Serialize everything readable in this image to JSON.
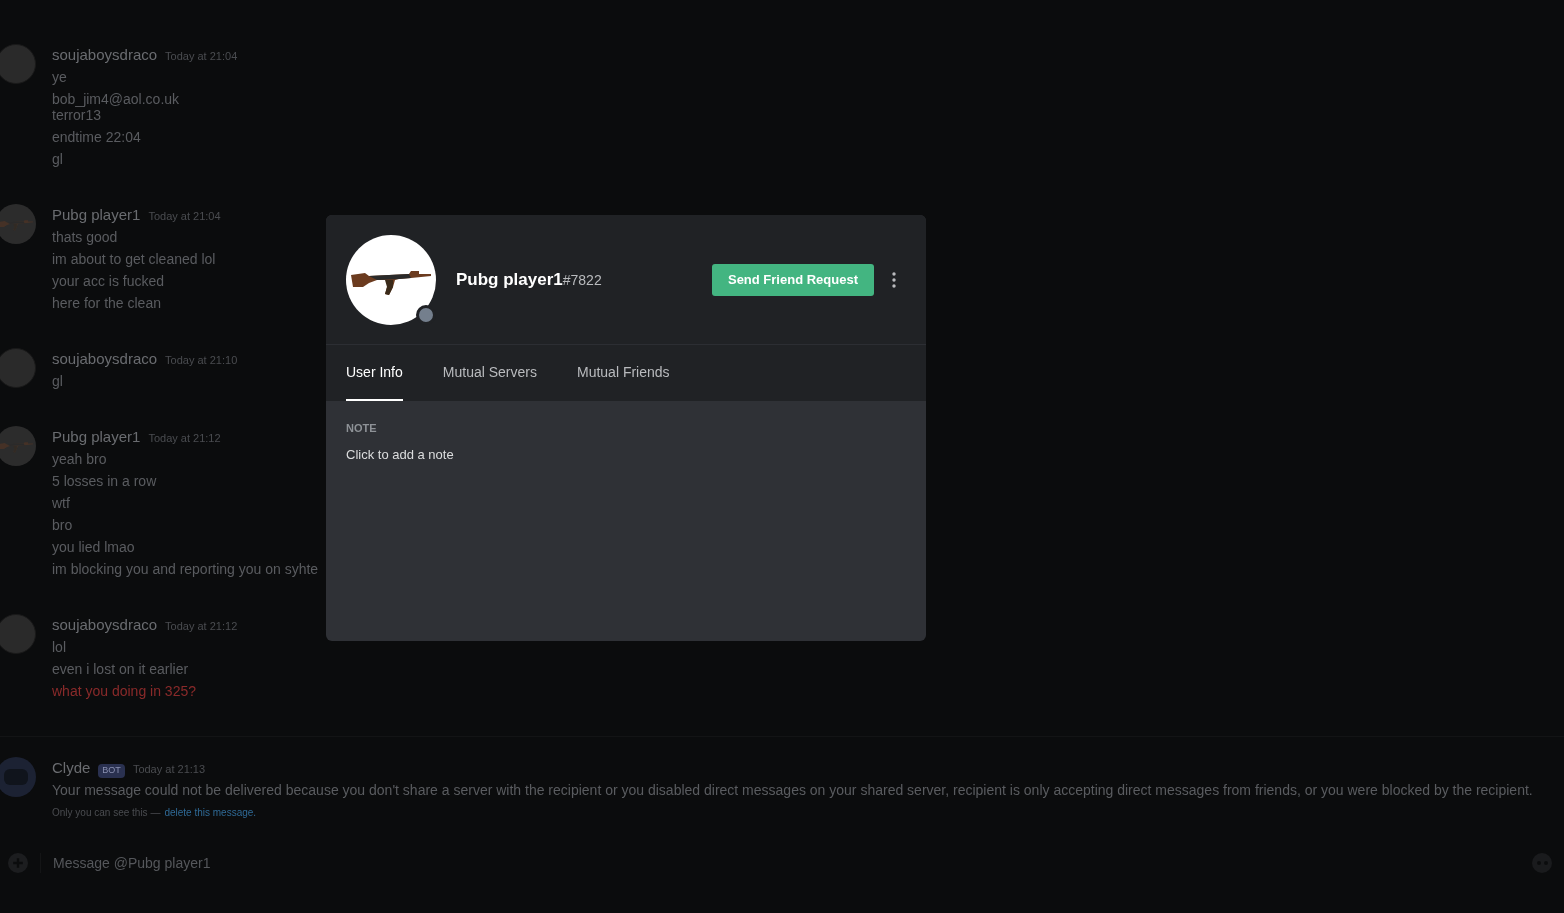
{
  "messages": [
    {
      "author": "soujaboysdraco",
      "time": "Today at 21:04",
      "kind": "face",
      "lines": [
        {
          "kind": "text",
          "text": "ye"
        },
        {
          "kind": "text",
          "text": "bob_jim4@aol.co.uk\nterror13"
        },
        {
          "kind": "text",
          "text": "endtime 22:04"
        },
        {
          "kind": "text",
          "text": "gl"
        }
      ]
    },
    {
      "author": "Pubg player1",
      "time": "Today at 21:04",
      "kind": "rifle",
      "lines": [
        {
          "kind": "text",
          "text": "thats good"
        },
        {
          "kind": "text",
          "text": "im about to get cleaned lol"
        },
        {
          "kind": "text",
          "text": "your acc is fucked"
        },
        {
          "kind": "text",
          "text": "here for the clean"
        }
      ]
    },
    {
      "author": "soujaboysdraco",
      "time": "Today at 21:10",
      "kind": "face",
      "lines": [
        {
          "kind": "text",
          "text": "gl"
        }
      ]
    },
    {
      "author": "Pubg player1",
      "time": "Today at 21:12",
      "kind": "rifle",
      "lines": [
        {
          "kind": "text",
          "text": "yeah bro"
        },
        {
          "kind": "text",
          "text": "5 losses in a row"
        },
        {
          "kind": "text",
          "text": "wtf"
        },
        {
          "kind": "text",
          "text": "bro"
        },
        {
          "kind": "text",
          "text": "you lied lmao"
        },
        {
          "kind": "text",
          "text": "im blocking you and reporting you on syhte"
        }
      ]
    },
    {
      "author": "soujaboysdraco",
      "time": "Today at 21:12",
      "kind": "face",
      "lines": [
        {
          "kind": "text",
          "text": "lol"
        },
        {
          "kind": "text",
          "text": "even i lost on it earlier"
        },
        {
          "kind": "failed",
          "text": "what you doing in 325?"
        }
      ]
    },
    {
      "author": "Clyde",
      "badge": "BOT",
      "time": "Today at 21:13",
      "kind": "bot",
      "lines": [
        {
          "kind": "text",
          "text": "Your message could not be delivered because you don't share a server with the recipient or you disabled direct messages on your shared server, recipient is only accepting direct messages from friends, or you were blocked by the recipient."
        }
      ],
      "notice": "Only you can see this —",
      "notice_link": "delete this message."
    }
  ],
  "composer": {
    "placeholder": "Message @Pubg player1"
  },
  "profile": {
    "name": "Pubg player1",
    "tag": "#7822",
    "online": false,
    "action": "Send Friend Request",
    "tabs": [
      {
        "label": "User Info",
        "selected": true
      },
      {
        "label": "Mutual Servers",
        "selected": false
      },
      {
        "label": "Mutual Friends",
        "selected": false
      }
    ],
    "note_heading": "NOTE",
    "note_placeholder": "Click to add a note"
  }
}
